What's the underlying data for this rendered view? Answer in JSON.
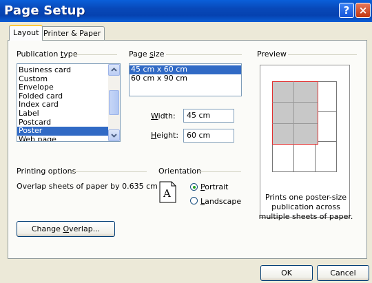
{
  "window": {
    "title": "Page Setup",
    "help_label": "?",
    "close_label": "×"
  },
  "tabs": [
    "Layout",
    "Printer & Paper"
  ],
  "publication_type": {
    "label": "Publication type",
    "items": [
      "Business card",
      "Custom",
      "Envelope",
      "Folded card",
      "Index card",
      "Label",
      "Postcard",
      "Poster",
      "Web page"
    ],
    "selected": "Poster"
  },
  "page_size": {
    "label": "Page size",
    "items": [
      "45 cm x 60 cm",
      "60 cm x 90 cm"
    ],
    "selected": "45 cm x 60 cm"
  },
  "width": {
    "label": "Width:",
    "value": "45 cm"
  },
  "height": {
    "label": "Height:",
    "value": "60 cm"
  },
  "preview": {
    "label": "Preview",
    "description": "Prints one poster-size publication across multiple sheets of paper.",
    "highlight_color": "#C8C8C8",
    "border_color": "#E03030"
  },
  "printing_options": {
    "label": "Printing options",
    "overlap_text": "Overlap sheets of paper by 0.635 cm",
    "change_overlap_label": "Change Overlap..."
  },
  "orientation": {
    "label": "Orientation",
    "portrait_label": "Portrait",
    "landscape_label": "Landscape",
    "selected": "Portrait",
    "icon_letter": "A"
  },
  "buttons": {
    "ok": "OK",
    "cancel": "Cancel"
  },
  "colors": {
    "title_bar": "#0A5FD9",
    "selection": "#316AC5",
    "dialog_bg": "#ECE9D8"
  }
}
